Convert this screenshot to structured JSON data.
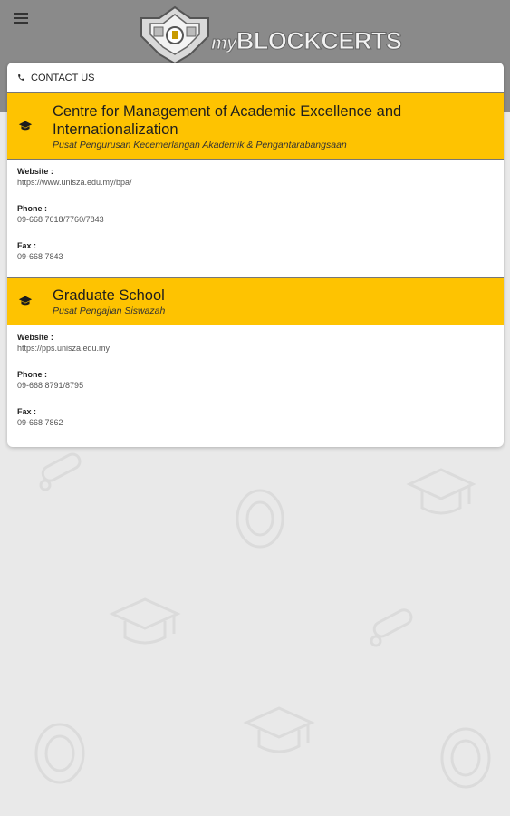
{
  "app": {
    "logo_prefix": "my",
    "logo_main": "BLOCKCERTS"
  },
  "card": {
    "header_label": "CONTACT US",
    "sections": [
      {
        "title": "Centre for Management of Academic Excellence and Internationalization",
        "subtitle": "Pusat Pengurusan Kecemerlangan Akademik & Pengantarabangsaan",
        "website_label": "Website :",
        "website": "https://www.unisza.edu.my/bpa/",
        "phone_label": "Phone :",
        "phone": "09-668 7618/7760/7843",
        "fax_label": "Fax :",
        "fax": "09-668 7843"
      },
      {
        "title": "Graduate School",
        "subtitle": "Pusat Pengajian Siswazah",
        "website_label": "Website :",
        "website": "https://pps.unisza.edu.my",
        "phone_label": "Phone :",
        "phone": "09-668 8791/8795",
        "fax_label": "Fax :",
        "fax": "09-668 7862"
      }
    ]
  },
  "colors": {
    "topbar": "#8a8a8a",
    "accent": "#fec301",
    "background": "#e9e9e9"
  },
  "icons": [
    "menu-icon",
    "phone-icon",
    "graduation-cap-icon"
  ]
}
